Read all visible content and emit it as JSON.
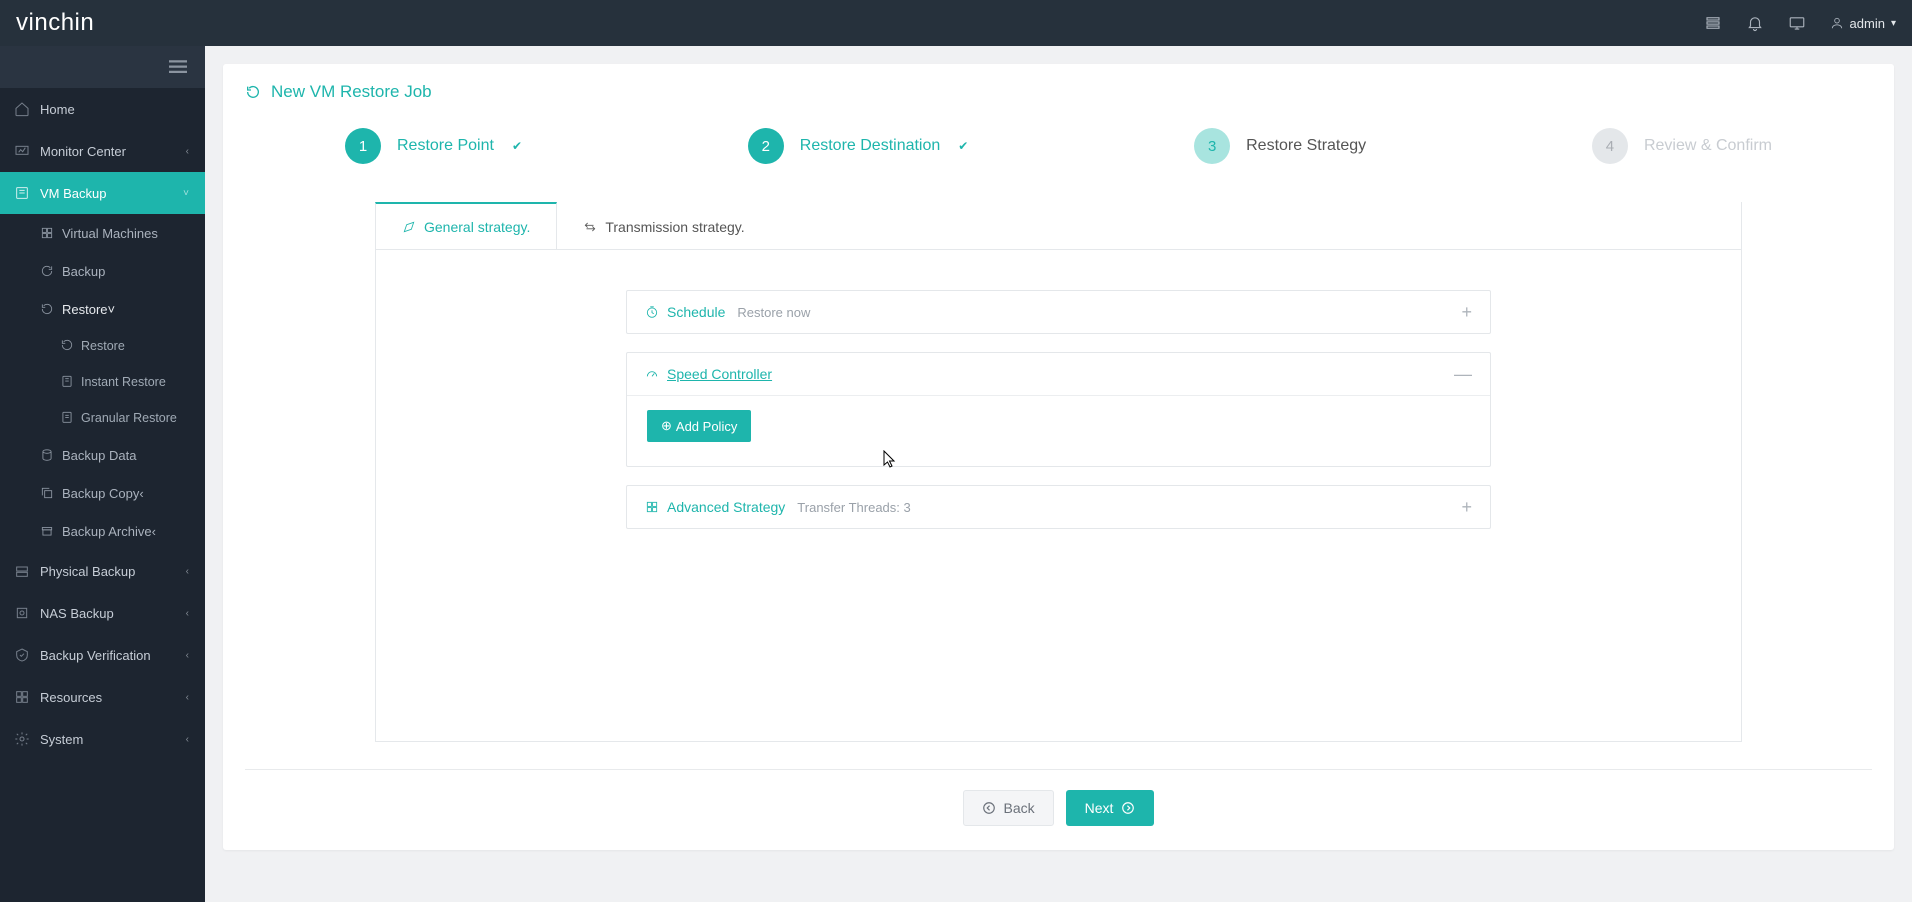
{
  "header": {
    "brand_prefix": "vin",
    "brand_suffix": "chin",
    "user": "admin"
  },
  "sidebar": {
    "home": "Home",
    "monitor": "Monitor Center",
    "vmbackup": "VM Backup",
    "vmbackup_children": {
      "vms": "Virtual Machines",
      "backup": "Backup",
      "restore": "Restore",
      "restore_children": {
        "restore": "Restore",
        "instant": "Instant Restore",
        "granular": "Granular Restore"
      },
      "backup_data": "Backup Data",
      "backup_copy": "Backup Copy",
      "backup_archive": "Backup Archive"
    },
    "physical": "Physical Backup",
    "nas": "NAS Backup",
    "verification": "Backup Verification",
    "resources": "Resources",
    "system": "System"
  },
  "page": {
    "title": "New VM Restore Job",
    "steps": {
      "s1": "Restore Point",
      "s2": "Restore Destination",
      "s3": "Restore Strategy",
      "s4": "Review & Confirm"
    },
    "tabs": {
      "general": "General strategy.",
      "transmission": "Transmission strategy."
    },
    "sections": {
      "schedule": {
        "title": "Schedule",
        "subtitle": "Restore now"
      },
      "speed": {
        "title": " Speed Controller",
        "add_policy": "Add Policy"
      },
      "advanced": {
        "title": "Advanced Strategy",
        "subtitle": "Transfer Threads: 3"
      }
    },
    "buttons": {
      "back": "Back",
      "next": "Next"
    }
  }
}
